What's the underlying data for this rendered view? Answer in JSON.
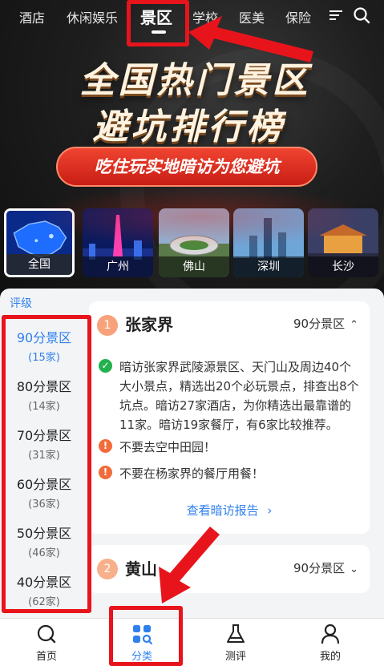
{
  "top_tabs": [
    "酒店",
    "休闲娱乐",
    "景区",
    "学校",
    "医美",
    "保险"
  ],
  "active_tab_index": 2,
  "hero": {
    "title_line1": "全国热门景区",
    "title_line2": "避坑排行榜",
    "banner": "吃住玩实地暗访为您避坑"
  },
  "cities": [
    "全国",
    "广州",
    "佛山",
    "深圳",
    "长沙"
  ],
  "active_city_index": 0,
  "sidebar": {
    "title": "评级",
    "grades": [
      {
        "name": "90分景区",
        "count": "(15家)"
      },
      {
        "name": "80分景区",
        "count": "(14家)"
      },
      {
        "name": "70分景区",
        "count": "(31家)"
      },
      {
        "name": "60分景区",
        "count": "(36家)"
      },
      {
        "name": "50分景区",
        "count": "(46家)"
      },
      {
        "name": "40分景区",
        "count": "(62家)"
      }
    ],
    "active_index": 0
  },
  "cards": [
    {
      "rank": "1",
      "name": "张家界",
      "grade": "90分景区",
      "summary": "暗访张家界武陵源景区、天门山及周边40个大小景点，精选出20个必玩景点，排查出8个坑点。暗访27家酒店，为你精选出最靠谱的11家。暗访19家餐厅，有6家比较推荐。",
      "warnings": [
        "不要去空中田园！",
        "不要在杨家界的餐厅用餐！"
      ],
      "report_link": "查看暗访报告"
    },
    {
      "rank": "2",
      "name": "黄山",
      "grade": "90分景区"
    }
  ],
  "bottom_nav": [
    {
      "label": "首页",
      "icon": "search-home-icon"
    },
    {
      "label": "分类",
      "icon": "category-icon"
    },
    {
      "label": "测评",
      "icon": "flask-icon"
    },
    {
      "label": "我的",
      "icon": "user-icon"
    }
  ],
  "active_nav_index": 1,
  "colors": {
    "accent": "#2f80ed",
    "annotation": "#e8141c",
    "banner": "#e0301f"
  }
}
